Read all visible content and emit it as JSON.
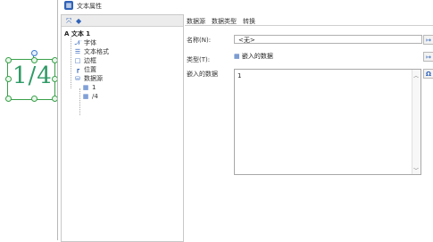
{
  "canvas": {
    "label_text": "1/4"
  },
  "dialog": {
    "title": "文本属性",
    "tree": {
      "root": "A 文本 1",
      "items": [
        {
          "label": "字体",
          "icon": "font-icon"
        },
        {
          "label": "文本格式",
          "icon": "text-format-icon"
        },
        {
          "label": "边框",
          "icon": "border-icon"
        },
        {
          "label": "位置",
          "icon": "position-icon"
        },
        {
          "label": "数据源",
          "icon": "datasource-icon"
        }
      ],
      "subitems": [
        {
          "label": "1",
          "icon": "embedded-data-icon"
        },
        {
          "label": "/4",
          "icon": "embedded-data-icon"
        }
      ]
    },
    "tabs": [
      {
        "label": "数据源"
      },
      {
        "label": "数据类型"
      },
      {
        "label": "转换"
      }
    ],
    "form": {
      "name_label": "名称(N):",
      "name_value": "<无>",
      "type_label": "类型(T):",
      "type_value": "嵌入的数据",
      "embedded_label": "嵌入的数据",
      "embedded_value": "1"
    }
  }
}
